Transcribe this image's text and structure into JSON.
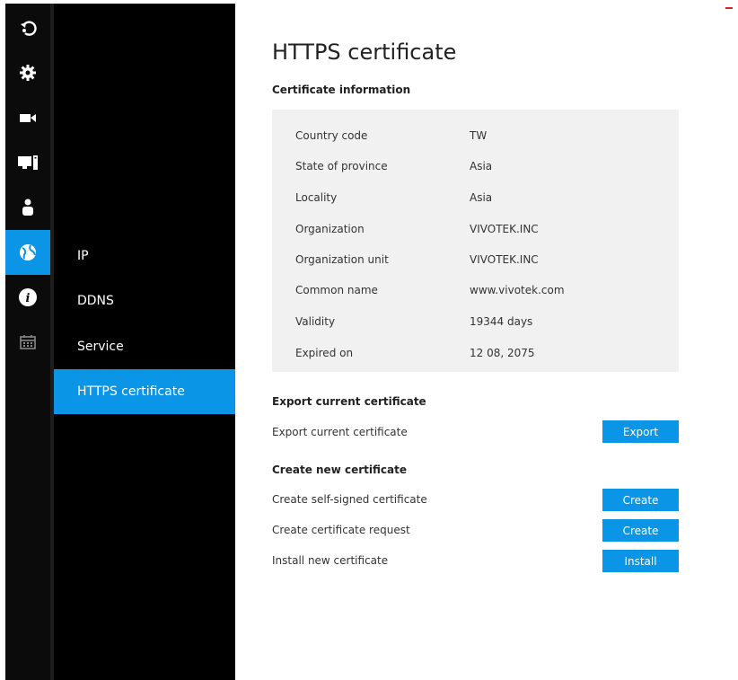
{
  "colors": {
    "accent": "#0b95e6",
    "sidebar_bg": "#000000",
    "panel_bg": "#f1f1f1"
  },
  "icon_rail": [
    {
      "icon": "logout-icon"
    },
    {
      "icon": "gear-icon"
    },
    {
      "icon": "video-camera-icon"
    },
    {
      "icon": "display-icon"
    },
    {
      "icon": "user-icon"
    },
    {
      "icon": "globe-icon",
      "active": true
    },
    {
      "icon": "info-icon"
    },
    {
      "icon": "calendar-icon"
    }
  ],
  "submenu": {
    "items": [
      {
        "label": "IP"
      },
      {
        "label": "DDNS"
      },
      {
        "label": "Service"
      },
      {
        "label": "HTTPS certificate",
        "active": true
      }
    ]
  },
  "page": {
    "title": "HTTPS certificate",
    "cert_info_title": "Certificate information",
    "cert_info": [
      {
        "label": "Country code",
        "value": "TW"
      },
      {
        "label": "State of province",
        "value": "Asia"
      },
      {
        "label": "Locality",
        "value": "Asia"
      },
      {
        "label": "Organization",
        "value": "VIVOTEK.INC"
      },
      {
        "label": "Organization unit",
        "value": "VIVOTEK.INC"
      },
      {
        "label": "Common name",
        "value": "www.vivotek.com"
      },
      {
        "label": "Validity",
        "value": "19344 days"
      },
      {
        "label": "Expired on",
        "value": "12 08, 2075"
      }
    ],
    "export_section_title": "Export current certificate",
    "export_label": "Export current certificate",
    "export_button": "Export",
    "create_section_title": "Create new certificate",
    "self_signed_label": "Create self-signed certificate",
    "self_signed_button": "Create",
    "request_label": "Create certificate request",
    "request_button": "Create",
    "install_label": "Install new certificate",
    "install_button": "Install"
  }
}
